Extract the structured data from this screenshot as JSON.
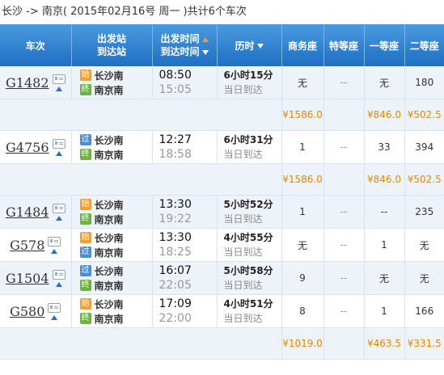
{
  "summary": {
    "route": "长沙 -> 南京",
    "date": "( 2015年02月16号  周一 )",
    "count": "共计6个车次"
  },
  "headers": {
    "train": "车次",
    "station_a": "出发站",
    "station_b": "到达站",
    "time_a": "出发时间",
    "time_b": "到达时间",
    "duration": "历时",
    "business": "商务座",
    "special": "特等座",
    "first": "一等座",
    "second": "二等座"
  },
  "trains": [
    {
      "no": "G1482",
      "from_tag": "始",
      "to_tag": "终",
      "from": "长沙南",
      "to": "南京南",
      "dep": "08:50",
      "arr": "15:05",
      "dur": "6小时15分",
      "arrive_day": "当日到达",
      "business": "无",
      "special": "--",
      "first": "无",
      "second": "180",
      "price": {
        "business": "¥1586.0",
        "first": "¥846.0",
        "second": "¥502.5"
      }
    },
    {
      "no": "G4756",
      "from_tag": "过",
      "to_tag": "终",
      "from": "长沙南",
      "to": "南京南",
      "dep": "12:27",
      "arr": "18:58",
      "dur": "6小时31分",
      "arrive_day": "当日到达",
      "business": "1",
      "special": "--",
      "first": "33",
      "second": "394",
      "price": {
        "business": "¥1586.0",
        "first": "¥846.0",
        "second": "¥502.5"
      }
    },
    {
      "no": "G1484",
      "from_tag": "始",
      "to_tag": "终",
      "from": "长沙南",
      "to": "南京南",
      "dep": "13:30",
      "arr": "19:22",
      "dur": "5小时52分",
      "arrive_day": "当日到达",
      "business": "1",
      "special": "--",
      "first": "--",
      "second": "235"
    },
    {
      "no": "G578",
      "from_tag": "始",
      "to_tag": "过",
      "from": "长沙南",
      "to": "南京南",
      "dep": "13:30",
      "arr": "18:25",
      "dur": "4小时55分",
      "arrive_day": "当日到达",
      "business": "无",
      "special": "--",
      "first": "1",
      "second": "无"
    },
    {
      "no": "G1504",
      "from_tag": "过",
      "to_tag": "终",
      "from": "长沙南",
      "to": "南京南",
      "dep": "16:07",
      "arr": "22:05",
      "dur": "5小时58分",
      "arrive_day": "当日到达",
      "business": "9",
      "special": "--",
      "first": "无",
      "second": "无"
    },
    {
      "no": "G580",
      "from_tag": "始",
      "to_tag": "终",
      "from": "长沙南",
      "to": "南京南",
      "dep": "17:09",
      "arr": "22:00",
      "dur": "4小时51分",
      "arrive_day": "当日到达",
      "business": "8",
      "special": "--",
      "first": "1",
      "second": "166",
      "price": {
        "business": "¥1019.0",
        "first": "¥463.5",
        "second": "¥331.5"
      }
    }
  ]
}
